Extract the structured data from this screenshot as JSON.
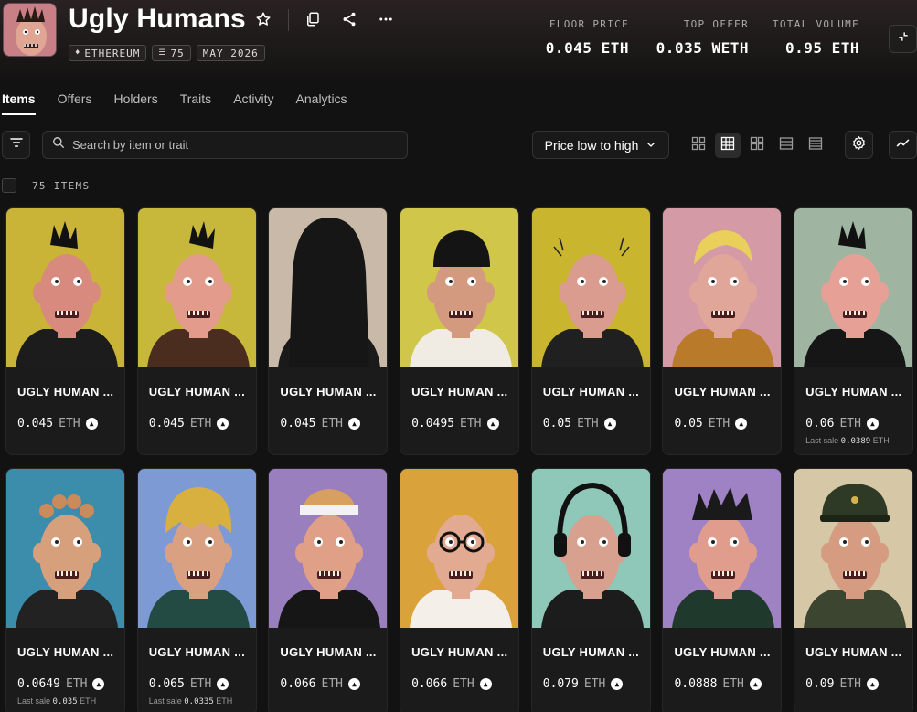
{
  "collection": {
    "title": "Ugly Humans",
    "chips": [
      {
        "icon": "ethereum-icon",
        "label": "ETHEREUM"
      },
      {
        "icon": "layers-icon",
        "label": "75"
      },
      {
        "icon": "",
        "label": "MAY 2026"
      }
    ]
  },
  "stats": [
    {
      "label": "FLOOR PRICE",
      "value": "0.045 ETH"
    },
    {
      "label": "TOP OFFER",
      "value": "0.035 WETH"
    },
    {
      "label": "TOTAL VOLUME",
      "value": "0.95 ETH"
    }
  ],
  "tabs": [
    "Items",
    "Offers",
    "Holders",
    "Traits",
    "Activity",
    "Analytics"
  ],
  "toolbar": {
    "search_placeholder": "Search by item or trait",
    "sort_label": "Price low to high"
  },
  "items_count": "75 ITEMS",
  "items": [
    {
      "name": "UGLY HUMAN ...",
      "price": "0.045",
      "currency": "ETH",
      "last_sale_label": "",
      "last_sale": "",
      "bg": "#c9b437",
      "skin": "#d88a7e",
      "hair": "mohawk",
      "cloth": "#1c1c1c"
    },
    {
      "name": "UGLY HUMAN ...",
      "price": "0.045",
      "currency": "ETH",
      "last_sale_label": "",
      "last_sale": "",
      "bg": "#c7b83c",
      "skin": "#e39c8c",
      "hair": "spiky",
      "cloth": "#4a2d1e"
    },
    {
      "name": "UGLY HUMAN ...",
      "price": "0.045",
      "currency": "ETH",
      "last_sale_label": "",
      "last_sale": "",
      "bg": "#c8b9a8",
      "skin": "#d5968a",
      "hair": "hood",
      "cloth": "#1a1a1a"
    },
    {
      "name": "UGLY HUMAN ...",
      "price": "0.0495",
      "currency": "ETH",
      "last_sale_label": "",
      "last_sale": "",
      "bg": "#cfc64a",
      "skin": "#d49a80",
      "hair": "beanie",
      "cloth": "#f0ece4"
    },
    {
      "name": "UGLY HUMAN ...",
      "price": "0.05",
      "currency": "ETH",
      "last_sale_label": "",
      "last_sale": "",
      "bg": "#c9b62e",
      "skin": "#d99c8e",
      "hair": "bald",
      "cloth": "#202020"
    },
    {
      "name": "UGLY HUMAN ...",
      "price": "0.05",
      "currency": "ETH",
      "last_sale_label": "",
      "last_sale": "",
      "bg": "#d49aa6",
      "skin": "#e0a69a",
      "hair": "blonde",
      "cloth": "#b97a2a"
    },
    {
      "name": "UGLY HUMAN ...",
      "price": "0.06",
      "currency": "ETH",
      "last_sale_label": "Last sale",
      "last_sale": "0.0389",
      "bg": "#9fb5a2",
      "skin": "#e6a096",
      "hair": "mohawk",
      "cloth": "#161616"
    },
    {
      "name": "UGLY HUMAN ...",
      "price": "0.0649",
      "currency": "ETH",
      "last_sale_label": "Last sale",
      "last_sale": "0.035",
      "bg": "#3c8cab",
      "skin": "#d7a07c",
      "hair": "curly",
      "cloth": "#222222"
    },
    {
      "name": "UGLY HUMAN ...",
      "price": "0.065",
      "currency": "ETH",
      "last_sale_label": "Last sale",
      "last_sale": "0.0335",
      "bg": "#7d9ad4",
      "skin": "#d9a182",
      "hair": "bowl",
      "cloth": "#244a44"
    },
    {
      "name": "UGLY HUMAN ...",
      "price": "0.066",
      "currency": "ETH",
      "last_sale_label": "",
      "last_sale": "",
      "bg": "#9a7fbe",
      "skin": "#e0a088",
      "hair": "headband",
      "cloth": "#161616"
    },
    {
      "name": "UGLY HUMAN ...",
      "price": "0.066",
      "currency": "ETH",
      "last_sale_label": "",
      "last_sale": "",
      "bg": "#d9a23a",
      "skin": "#e3aa92",
      "hair": "glasses",
      "cloth": "#f4efe8"
    },
    {
      "name": "UGLY HUMAN ...",
      "price": "0.079",
      "currency": "ETH",
      "last_sale_label": "",
      "last_sale": "",
      "bg": "#8fc7b8",
      "skin": "#d8a08e",
      "hair": "headphones",
      "cloth": "#1c1c1c"
    },
    {
      "name": "UGLY HUMAN ...",
      "price": "0.0888",
      "currency": "ETH",
      "last_sale_label": "",
      "last_sale": "",
      "bg": "#9f82c4",
      "skin": "#e09d8e",
      "hair": "messy",
      "cloth": "#1f3a2c"
    },
    {
      "name": "UGLY HUMAN ...",
      "price": "0.09",
      "currency": "ETH",
      "last_sale_label": "",
      "last_sale": "",
      "bg": "#d6c7a6",
      "skin": "#d59c82",
      "hair": "cap",
      "cloth": "#3c4530"
    }
  ],
  "icons": {
    "star": "star-icon",
    "copy": "copy-icon",
    "share": "share-icon",
    "more": "more-icon",
    "filter": "filter-icon",
    "search": "search-icon",
    "settings": "gear-icon",
    "chart": "trend-icon"
  }
}
